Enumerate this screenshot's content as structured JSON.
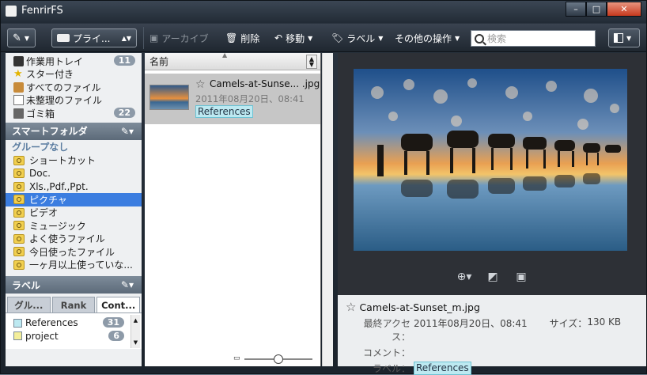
{
  "window": {
    "title": "FenrirFS",
    "minimize": "–",
    "maximize": "□",
    "close": "✕"
  },
  "toolbar": {
    "profile_label": "プライ...",
    "archive_label": "アーカイブ",
    "delete_label": "削除",
    "move_label": "移動",
    "label_label": "ラベル",
    "other_label": "その他の操作",
    "search_placeholder": "検索"
  },
  "sidebar": {
    "items": [
      {
        "label": "作業用トレイ",
        "count": "11"
      },
      {
        "label": "スター付き"
      },
      {
        "label": "すべてのファイル"
      },
      {
        "label": "未整理のファイル"
      },
      {
        "label": "ゴミ箱",
        "count": "22"
      }
    ],
    "smart_folder_header": "スマートフォルダ",
    "group_none": "グループなし",
    "folders": [
      "ショートカット",
      "Doc.",
      "Xls.,Pdf.,Ppt.",
      "ピクチャ",
      "ビデオ",
      "ミュージック",
      "よく使うファイル",
      "今日使ったファイル",
      "一ヶ月以上使っていな..."
    ],
    "selected_folder_index": 3,
    "label_header": "ラベル",
    "tabs": [
      "グル...",
      "Rank",
      "Cont..."
    ],
    "labels": [
      {
        "name": "References",
        "count": "31",
        "color": "#bde9f1"
      },
      {
        "name": "project",
        "count": "6",
        "color": "#f3ee9b"
      }
    ]
  },
  "filelist": {
    "column_name": "名前",
    "file": {
      "name": "Camels-at-Sunse... .jpg",
      "date": "2011年08月20日、08:41",
      "label": "References"
    },
    "zoom_fraction": 0.5
  },
  "preview": {
    "file_name": "Camels-at-Sunset_m.jpg",
    "last_access_key": "最終アクセス：",
    "last_access_val": "2011年08月20日、08:41",
    "size_key": "サイズ：",
    "size_val": "130 KB",
    "comment_key": "コメント：",
    "label_key": "ラベル：",
    "label_val": "References"
  },
  "icons": {
    "profile": "drive-icon",
    "zoom": "zoom-in-icon",
    "fit": "fit-icon",
    "fullscreen": "fullscreen-icon"
  }
}
